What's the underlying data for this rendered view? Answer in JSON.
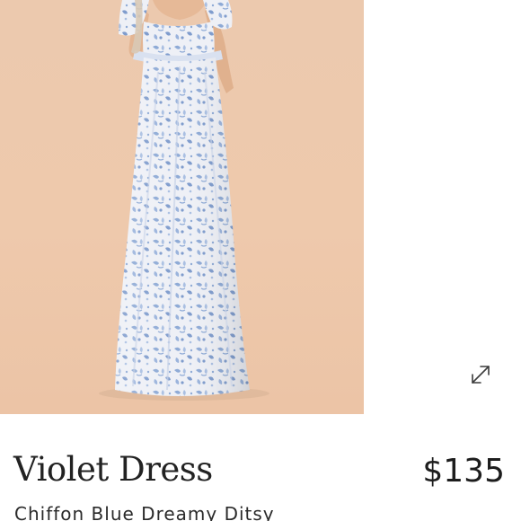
{
  "product": {
    "name": "Violet Dress",
    "price": "$135",
    "variant": "Chiffon Blue Dreamy Ditsy"
  },
  "icons": {
    "expand": "expand-arrows-icon"
  },
  "colors": {
    "photo_background": "#ecc8ab",
    "dress_base": "#eef0f6",
    "dress_pattern": "#8eaad6",
    "text": "#222222"
  }
}
